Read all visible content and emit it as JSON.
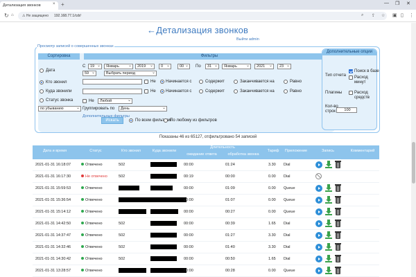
{
  "browser": {
    "tab_title": "Детализация звонков",
    "tab_close": "×",
    "new_tab": "+",
    "min": "—",
    "max": "❐",
    "close": "✕",
    "not_secure": "⚠ Не защищено",
    "url": "192.168.77.1/cdr/"
  },
  "page": {
    "title": "←Детализация звонков",
    "logout": "Выйти admin"
  },
  "filters": {
    "legend": "Просмотр записей о совершенных звонках",
    "sort_header": "Сортировка",
    "filters_header": "Фильтры",
    "sort_options": [
      "Дата",
      "Кто звонил",
      "Куда звонили",
      "Статус звонка"
    ],
    "sort_selected": "Кто звонил",
    "sort_order": "по убыванию",
    "date_from_label": "С",
    "date_from": {
      "day": "19",
      "month": "Январь",
      "year": "2019",
      "hour": "0",
      "minute": "00"
    },
    "date_to_label": "По",
    "date_to": {
      "day": "31",
      "month": "Январь",
      "year": "2021",
      "hour": "23",
      "minute": "59"
    },
    "period": "Выбрать период",
    "not_label": "Не",
    "match_options": [
      "Начинается с",
      "Содержит",
      "Заканчивается на",
      "Равно"
    ],
    "status_any": "Любой",
    "group_by_label": "Группировать по",
    "group_by": "День",
    "extra_filters": "Дополнительные фильтры",
    "search_button": "Искать",
    "all_filters": "По всем фильтрам",
    "any_filter": "По любому из фильтров"
  },
  "options": {
    "header": "Дополнительные опции",
    "report_type_label": "Тип отчета",
    "search_db": "Поиск в базе",
    "minute_cost": "Расход минут",
    "plugins_label": "Плагины",
    "funds_cost": "Расход средств",
    "rows_label": "Кол-во строк",
    "rows_value": "100"
  },
  "summary": "Показаны 46 из 65127, отфильтровано 54 записей",
  "table": {
    "columns": [
      "Дата и время",
      "Статус",
      "Кто звонил",
      "Куда звонили",
      "Длительность",
      "ожидание ответа",
      "обработка звонка",
      "Тариф",
      "Приложение",
      "Запись",
      "Комментарий"
    ],
    "rows": [
      {
        "datetime": "2021-01-31 16:18:07",
        "status": "Отвечено",
        "answered": true,
        "caller": "502",
        "wait": "00:00",
        "handle": "01:24",
        "tariff": "3.30",
        "app": "Dial"
      },
      {
        "datetime": "2021-01-31 16:17:30",
        "status": "Не отвечено",
        "answered": false,
        "caller": "502",
        "wait": "00:19",
        "handle": "00:00",
        "tariff": "0.00",
        "app": "Dial"
      },
      {
        "datetime": "2021-01-31 15:59:53",
        "status": "Отвечено",
        "answered": true,
        "caller": "",
        "wait": "00:00",
        "handle": "01:09",
        "tariff": "0.00",
        "app": "Queue"
      },
      {
        "datetime": "2021-01-31 15:36:54",
        "status": "Отвечено",
        "answered": true,
        "caller": "",
        "wait": "00:00",
        "handle": "01:07",
        "tariff": "0.00",
        "app": "Queue"
      },
      {
        "datetime": "2021-01-31 15:14:12",
        "status": "Отвечено",
        "answered": true,
        "caller": "",
        "wait": "00:00",
        "handle": "00:27",
        "tariff": "0.00",
        "app": "Queue"
      },
      {
        "datetime": "2021-01-31 14:42:50",
        "status": "Отвечено",
        "answered": true,
        "caller": "502",
        "wait": "00:00",
        "handle": "00:39",
        "tariff": "1.65",
        "app": "Dial"
      },
      {
        "datetime": "2021-01-31 14:37:47",
        "status": "Отвечено",
        "answered": true,
        "caller": "502",
        "wait": "00:00",
        "handle": "01:27",
        "tariff": "3.30",
        "app": "Dial"
      },
      {
        "datetime": "2021-01-31 14:32:46",
        "status": "Отвечено",
        "answered": true,
        "caller": "502",
        "wait": "00:00",
        "handle": "01:40",
        "tariff": "3.30",
        "app": "Dial"
      },
      {
        "datetime": "2021-01-31 14:30:42",
        "status": "Отвечено",
        "answered": true,
        "caller": "502",
        "wait": "00:00",
        "handle": "00:50",
        "tariff": "1.65",
        "app": "Dial"
      },
      {
        "datetime": "2021-01-31 13:28:57",
        "status": "Отвечено",
        "answered": true,
        "caller": "",
        "wait": "00:00",
        "handle": "00:28",
        "tariff": "0.00",
        "app": "Queue"
      }
    ]
  },
  "colors": {
    "accent": "#3f7bc0",
    "header": "#8dc4ec",
    "answered": "#2fa84f",
    "not_answered": "#e03b3b",
    "redaction": "#000000"
  }
}
